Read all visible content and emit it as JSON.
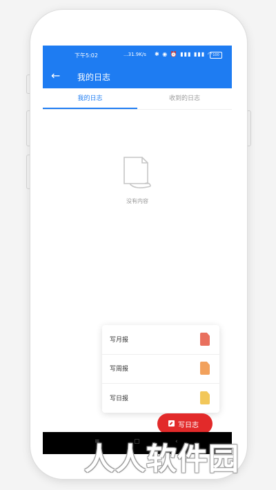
{
  "status_bar": {
    "time": "下午5:02",
    "network_speed": "...31.9K/s",
    "icons": [
      "bluetooth-icon",
      "vibrate-icon",
      "alarm-icon",
      "signal-icon",
      "signal-icon",
      "wifi-icon"
    ],
    "icon_glyphs": "✱ ◉ ⏰ ▮▮▮ ▮▮▮ ◠",
    "battery": "100"
  },
  "app_bar": {
    "back_icon": "←",
    "title": "我的日志"
  },
  "tabs": [
    {
      "label": "我的日志",
      "active": true
    },
    {
      "label": "收到的日志",
      "active": false
    }
  ],
  "empty_state": {
    "icon": "document-icon",
    "text": "没有内容"
  },
  "popup_menu": {
    "items": [
      {
        "label": "写月报",
        "color": "#e9705e"
      },
      {
        "label": "写周报",
        "color": "#f2a15c"
      },
      {
        "label": "写日报",
        "color": "#f2c75a"
      }
    ]
  },
  "fab": {
    "label": "写日志",
    "color": "#e22a2a"
  },
  "nav_bar": {
    "menu_icon": "≡",
    "home_icon": "▢",
    "back_icon": "‹"
  },
  "watermark": "人人软件园",
  "colors": {
    "primary": "#1e7cf2"
  }
}
